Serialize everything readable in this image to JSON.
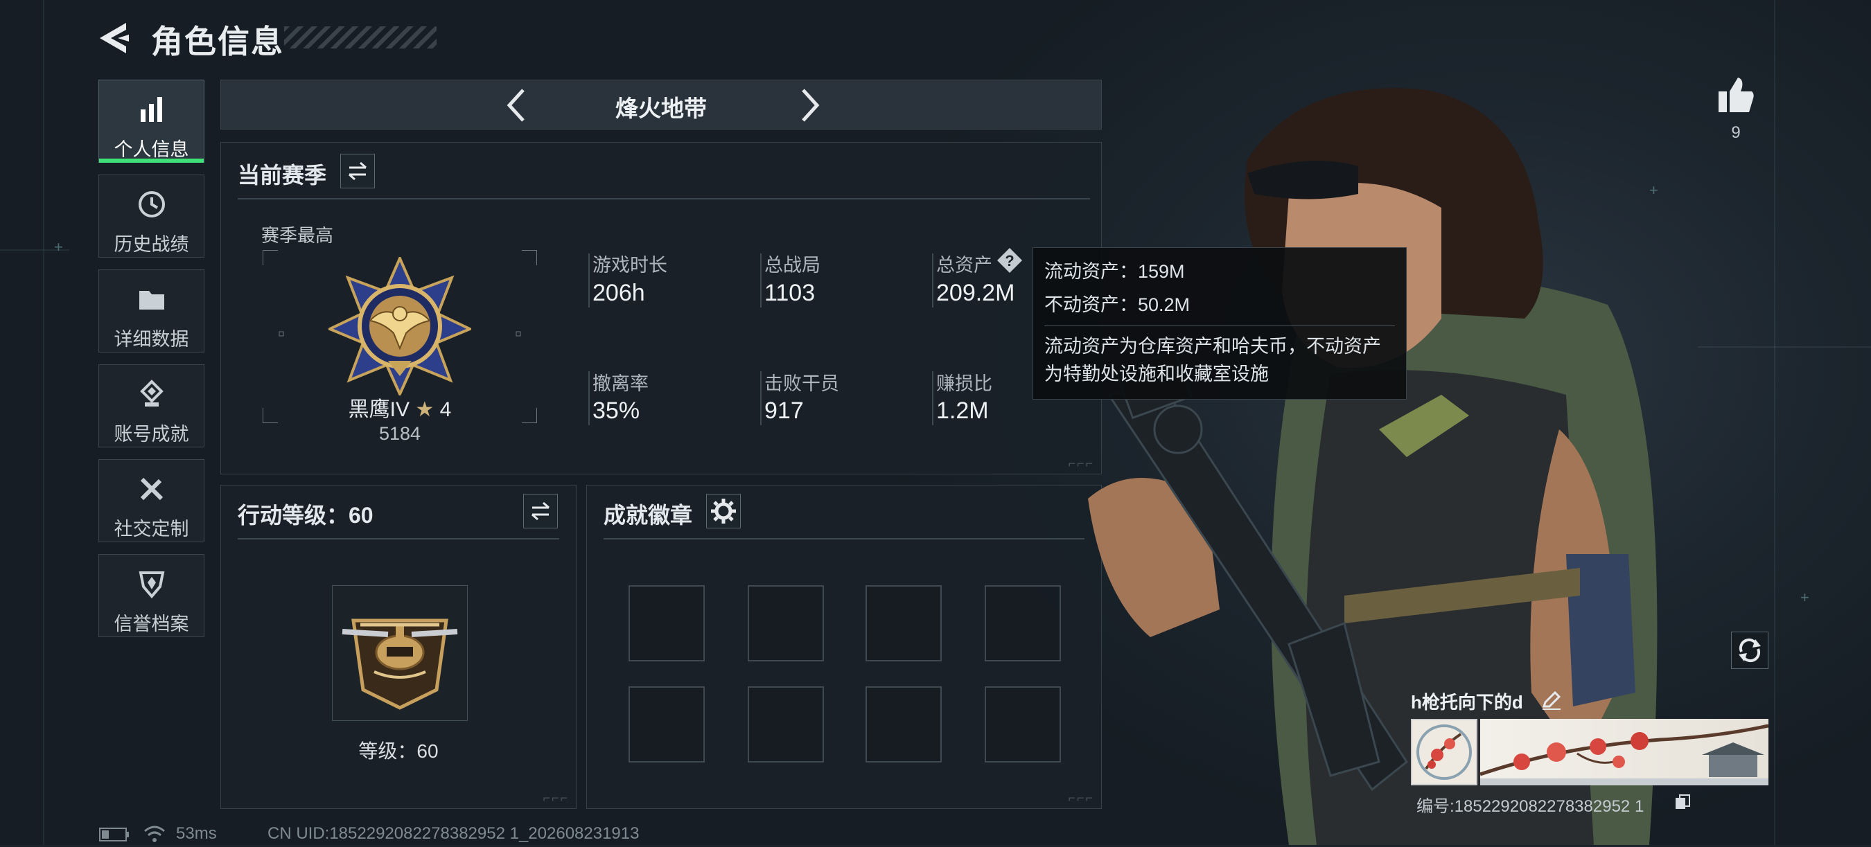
{
  "header": {
    "title": "角色信息"
  },
  "nav": {
    "items": [
      {
        "label": "个人信息",
        "icon": "bar-chart-icon",
        "active": true
      },
      {
        "label": "历史战绩",
        "icon": "history-icon"
      },
      {
        "label": "详细数据",
        "icon": "folder-icon"
      },
      {
        "label": "账号成就",
        "icon": "achievement-icon"
      },
      {
        "label": "社交定制",
        "icon": "wrench-icon"
      },
      {
        "label": "信誉档案",
        "icon": "shield-icon"
      }
    ]
  },
  "mode": {
    "name": "烽火地带"
  },
  "season": {
    "title": "当前赛季",
    "best_label": "赛季最高",
    "rank_name": "黑鹰IV",
    "rank_stars": "4",
    "rank_score": "5184",
    "stats": [
      {
        "label": "游戏时长",
        "value": "206h"
      },
      {
        "label": "总战局",
        "value": "1103"
      },
      {
        "label": "总资产",
        "value": "209.2M"
      },
      {
        "label": "撤离率",
        "value": "35%"
      },
      {
        "label": "击败干员",
        "value": "917"
      },
      {
        "label": "赚损比",
        "value": "1.2M"
      }
    ]
  },
  "tooltip": {
    "line1": "流动资产：159M",
    "line2": "不动资产：50.2M",
    "line3": "流动资产为仓库资产和哈夫币，不动资产",
    "line4": "为特勤处设施和收藏室设施"
  },
  "action_level": {
    "title": "行动等级：60",
    "level_text": "等级：60"
  },
  "badges": {
    "title": "成就徽章"
  },
  "likes": {
    "count": "9"
  },
  "profile": {
    "name": "h枪托向下的d",
    "id_text": "编号:1852292082278382952 1"
  },
  "status_bar": {
    "ping": "53ms",
    "uid": "CN UID:1852292082278382952 1_202608231913"
  },
  "colors": {
    "accent_green": "#3fe07a",
    "background": "#1b232b"
  }
}
